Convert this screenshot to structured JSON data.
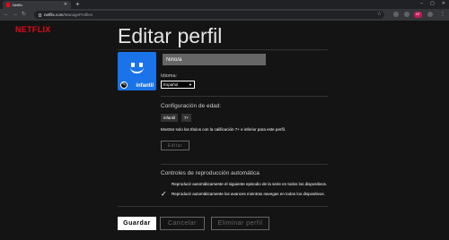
{
  "browser": {
    "tab_title": "Netflix",
    "url_host": "netflix.com",
    "url_path": "/ManageProfiles",
    "avatar_initials": "NT"
  },
  "brand": {
    "logo": "NETFLIX",
    "accent": "#e50914"
  },
  "page_title": "Editar perfil",
  "profile": {
    "name": "Niño/a",
    "avatar_label": "infantil",
    "avatar_color": "#1a73e8"
  },
  "language": {
    "label": "Idioma:",
    "selected": "Español"
  },
  "maturity": {
    "heading": "Configuración de edad:",
    "chips": [
      "infantil",
      "7+"
    ],
    "description": "Mostrar solo los títulos con la calificación 7+ e inferior para este perfil.",
    "edit_label": "Editar"
  },
  "autoplay": {
    "heading": "Controles de reproducción automática",
    "options": [
      {
        "label": "Reproducir automáticamente el siguiente episodio de la serie en todos los dispositivos.",
        "checked": false
      },
      {
        "label": "Reproducir automáticamente los avances mientras navegas en todos los dispositivos.",
        "checked": true
      }
    ]
  },
  "buttons": {
    "save": "Guardar",
    "cancel": "Cancelar",
    "delete": "Eliminar perfil"
  },
  "icons": {
    "back": "back-arrow-icon",
    "forward": "forward-arrow-icon",
    "reload": "reload-icon",
    "lock": "lock-icon",
    "star": "star-icon",
    "edit": "pencil-icon",
    "caret": "caret-down-icon",
    "check": "checkmark-icon"
  }
}
